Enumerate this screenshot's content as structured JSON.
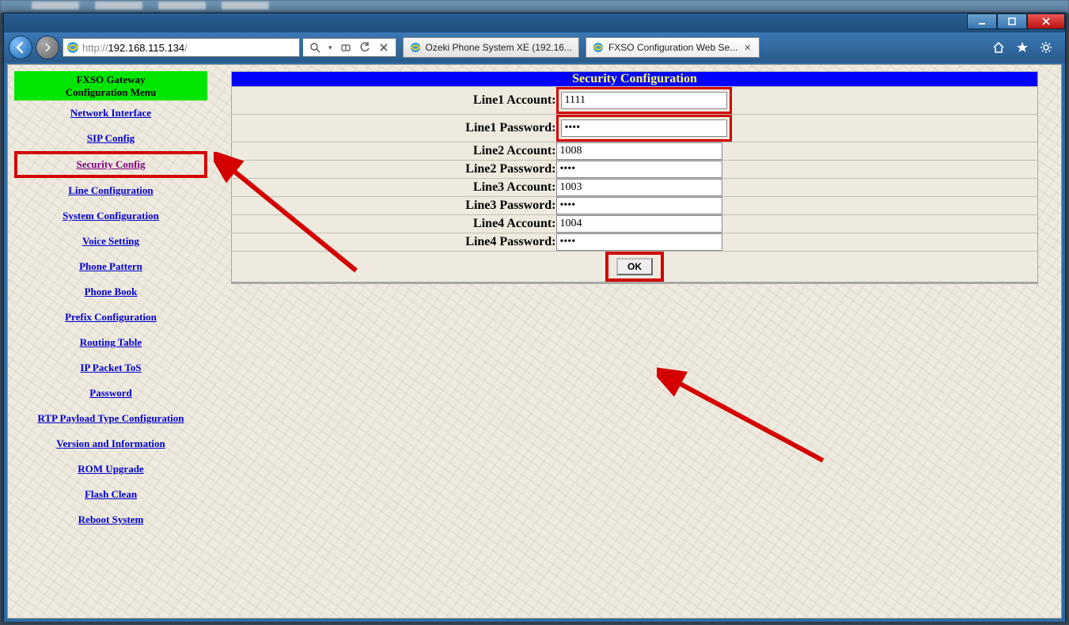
{
  "browser": {
    "url_display": "http://192.168.115.134/",
    "url_host": "192.168.115.134",
    "tabs": [
      {
        "title": "Ozeki Phone System XE (192.16...",
        "active": false
      },
      {
        "title": "FXSO Configuration Web Se...",
        "active": true
      }
    ]
  },
  "sidebar": {
    "header_line1": "FXSO Gateway",
    "header_line2": "Configuration Menu",
    "items": [
      {
        "label": "Network Interface"
      },
      {
        "label": "SIP Config"
      },
      {
        "label": "Security Config"
      },
      {
        "label": "Line Configuration"
      },
      {
        "label": "System Configuration"
      },
      {
        "label": "Voice Setting"
      },
      {
        "label": "Phone Pattern"
      },
      {
        "label": "Phone Book"
      },
      {
        "label": "Prefix Configuration"
      },
      {
        "label": "Routing Table"
      },
      {
        "label": "IP Packet ToS"
      },
      {
        "label": "Password"
      },
      {
        "label": "RTP Payload Type Configuration"
      },
      {
        "label": "Version and Information"
      },
      {
        "label": "ROM Upgrade"
      },
      {
        "label": "Flash Clean"
      },
      {
        "label": "Reboot System"
      }
    ]
  },
  "form": {
    "title": "Security Configuration",
    "rows": [
      {
        "label": "Line1 Account:",
        "value": "1111",
        "type": "text",
        "highlight": true
      },
      {
        "label": "Line1 Password:",
        "value": "••••",
        "type": "password",
        "highlight": true
      },
      {
        "label": "Line2 Account:",
        "value": "1008",
        "type": "text",
        "highlight": false
      },
      {
        "label": "Line2 Password:",
        "value": "••••",
        "type": "password",
        "highlight": false
      },
      {
        "label": "Line3 Account:",
        "value": "1003",
        "type": "text",
        "highlight": false
      },
      {
        "label": "Line3 Password:",
        "value": "••••",
        "type": "password",
        "highlight": false
      },
      {
        "label": "Line4 Account:",
        "value": "1004",
        "type": "text",
        "highlight": false
      },
      {
        "label": "Line4 Password:",
        "value": "••••",
        "type": "password",
        "highlight": false
      }
    ],
    "submit_label": "OK"
  }
}
